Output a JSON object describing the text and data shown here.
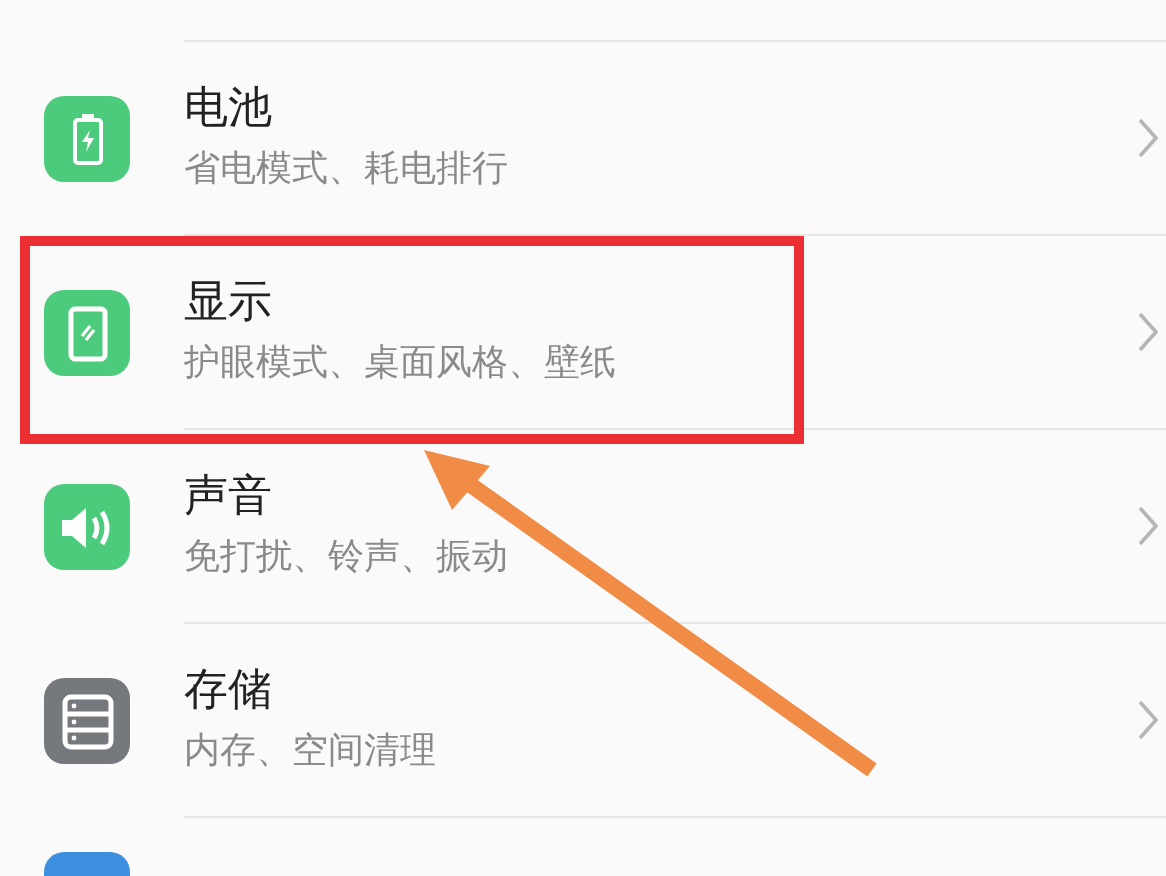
{
  "settings_items": [
    {
      "kind": "battery",
      "color": "#4dcb7c",
      "title": "电池",
      "subtitle": "省电模式、耗电排行"
    },
    {
      "kind": "display",
      "color": "#4dcb7c",
      "title": "显示",
      "subtitle": "护眼模式、桌面风格、壁纸"
    },
    {
      "kind": "sound",
      "color": "#4dcb7c",
      "title": "声音",
      "subtitle": "免打扰、铃声、振动"
    },
    {
      "kind": "storage",
      "color": "#75797d",
      "title": "存储",
      "subtitle": "内存、空间清理"
    }
  ]
}
